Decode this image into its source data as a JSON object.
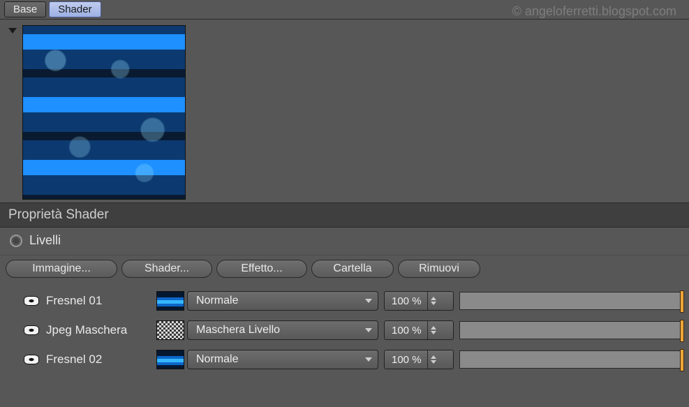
{
  "tabs": {
    "base": "Base",
    "shader": "Shader"
  },
  "watermark": "© angeloferretti.blogspot.com",
  "section_title": "Proprietà Shader",
  "radio": {
    "levels_label": "Livelli"
  },
  "buttons": {
    "image": "Immagine...",
    "shader": "Shader...",
    "effect": "Effetto...",
    "folder": "Cartella",
    "remove": "Rimuovi"
  },
  "layers": [
    {
      "name": "Fresnel 01",
      "blend": "Normale",
      "opacity": "100 %",
      "swatch": "banding"
    },
    {
      "name": "Jpeg Maschera",
      "blend": "Maschera Livello",
      "opacity": "100 %",
      "swatch": "noise"
    },
    {
      "name": "Fresnel 02",
      "blend": "Normale",
      "opacity": "100 %",
      "swatch": "banding"
    }
  ]
}
